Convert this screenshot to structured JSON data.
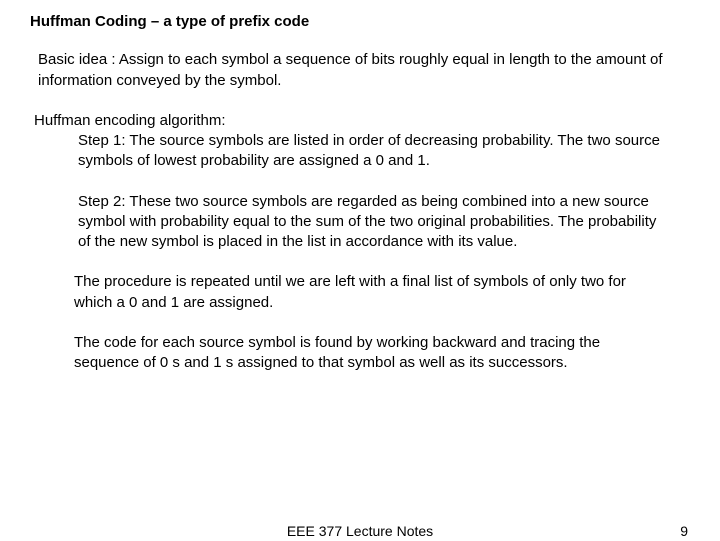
{
  "title": "Huffman Coding – a type of prefix code",
  "basic_idea": "Basic idea : Assign to each symbol a sequence of bits roughly equal in length to the amount of information conveyed by the symbol.",
  "algo_intro": "Huffman encoding algorithm:",
  "step1": "Step 1: The source symbols are listed in order of decreasing probability. The two source symbols of lowest probability are assigned a 0 and 1.",
  "step2": "Step 2: These two  source symbols are regarded as being combined into a new source symbol with probability equal to the sum of the two original probabilities. The probability of the new symbol is placed in the list in accordance with its value.",
  "para_repeat": "The procedure is repeated until we are left with a final list of symbols of only two for which a 0 and 1 are assigned.",
  "para_code": "The code for each source symbol is found by working backward and tracing the sequence of 0 s and 1 s assigned to that symbol as well as its successors.",
  "footer_center": "EEE 377 Lecture Notes",
  "footer_page": "9"
}
